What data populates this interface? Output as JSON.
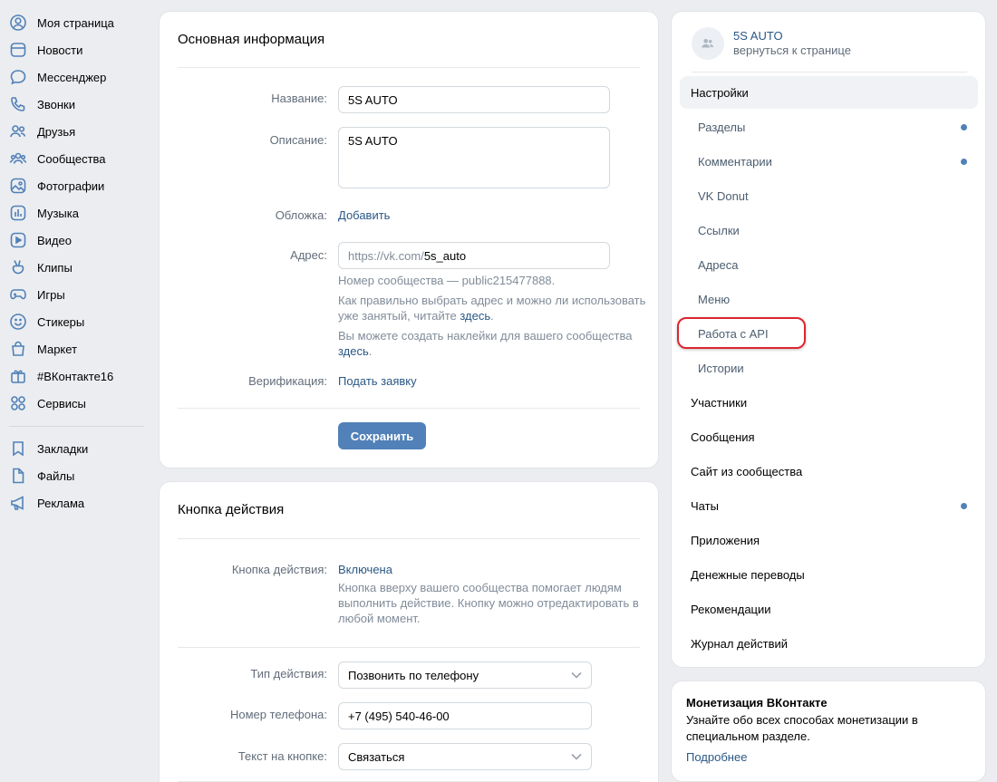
{
  "nav": {
    "items": [
      {
        "label": "Моя страница",
        "icon": "user-circle-icon"
      },
      {
        "label": "Новости",
        "icon": "news-icon"
      },
      {
        "label": "Мессенджер",
        "icon": "message-icon"
      },
      {
        "label": "Звонки",
        "icon": "phone-icon"
      },
      {
        "label": "Друзья",
        "icon": "friends-icon"
      },
      {
        "label": "Сообщества",
        "icon": "communities-icon"
      },
      {
        "label": "Фотографии",
        "icon": "photo-icon"
      },
      {
        "label": "Музыка",
        "icon": "music-icon"
      },
      {
        "label": "Видео",
        "icon": "video-icon"
      },
      {
        "label": "Клипы",
        "icon": "clips-icon"
      },
      {
        "label": "Игры",
        "icon": "gamepad-icon"
      },
      {
        "label": "Стикеры",
        "icon": "smile-icon"
      },
      {
        "label": "Маркет",
        "icon": "market-bag-icon"
      },
      {
        "label": "#ВКонтакте16",
        "icon": "gift-icon"
      },
      {
        "label": "Сервисы",
        "icon": "services-grid-icon"
      }
    ],
    "items2": [
      {
        "label": "Закладки",
        "icon": "bookmark-icon"
      },
      {
        "label": "Файлы",
        "icon": "file-icon"
      },
      {
        "label": "Реклама",
        "icon": "megaphone-icon"
      }
    ]
  },
  "main": {
    "title": "Основная информация",
    "name_label": "Название:",
    "name_value": "5S AUTO",
    "desc_label": "Описание:",
    "desc_value": "5S AUTO",
    "cover_label": "Обложка:",
    "cover_link": "Добавить",
    "address_label": "Адрес:",
    "address_prefix": "https://vk.com/",
    "address_value": "5s_auto",
    "hint1": "Номер сообщества — public215477888.",
    "hint2_text": "Как правильно выбрать адрес и можно ли использовать уже занятый, читайте ",
    "hint2_link": "здесь",
    "hint3_text": "Вы можете создать наклейки для вашего сообщества ",
    "hint3_link": "здесь",
    "verify_label": "Верификация:",
    "verify_link": "Подать заявку",
    "save_button": "Сохранить"
  },
  "action": {
    "title": "Кнопка действия",
    "button_label": "Кнопка действия:",
    "button_value": "Включена",
    "button_hint": "Кнопка вверху вашего сообщества помогает людям выполнить действие. Кнопку можно отредактировать в любой момент.",
    "type_label": "Тип действия:",
    "type_value": "Позвонить по телефону",
    "phone_label": "Номер телефона:",
    "phone_value": "+7 (495) 540-46-00",
    "text_label": "Текст на кнопке:",
    "text_value": "Связаться"
  },
  "menu": {
    "group_name": "5S AUTO",
    "back_label": "вернуться к странице",
    "settings": "Настройки",
    "sub_items": [
      {
        "label": "Разделы",
        "dot": true
      },
      {
        "label": "Комментарии",
        "dot": true
      },
      {
        "label": "VK Donut",
        "dot": false
      },
      {
        "label": "Ссылки",
        "dot": false
      },
      {
        "label": "Адреса",
        "dot": false
      },
      {
        "label": "Меню",
        "dot": false
      },
      {
        "label": "Работа с API",
        "dot": false
      },
      {
        "label": "Истории",
        "dot": false
      }
    ],
    "items": [
      {
        "label": "Участники",
        "dot": false
      },
      {
        "label": "Сообщения",
        "dot": false
      },
      {
        "label": "Сайт из сообщества",
        "dot": false
      },
      {
        "label": "Чаты",
        "dot": true
      },
      {
        "label": "Приложения",
        "dot": false
      },
      {
        "label": "Денежные переводы",
        "dot": false
      },
      {
        "label": "Рекомендации",
        "dot": false
      },
      {
        "label": "Журнал действий",
        "dot": false
      }
    ]
  },
  "monet": {
    "title": "Монетизация ВКонтакте",
    "text": "Узнайте обо всех способах монетизации в специальном разделе.",
    "link": "Подробнее"
  },
  "colors": {
    "accent": "#5181b8",
    "link": "#2a5885",
    "highlight": "#e0242f",
    "background": "#ebedf0"
  }
}
